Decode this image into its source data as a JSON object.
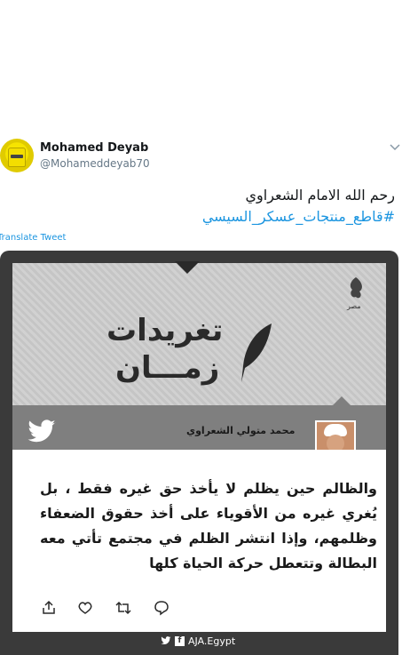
{
  "tweet": {
    "author_name": "Mohamed Deyab",
    "author_handle": "@Mohameddeyab70",
    "text_line1": "رحم الله الامام الشعراوي",
    "hashtag": "#قاطع_منتجات_عسكر_السيسي",
    "translate_label": "Translate Tweet"
  },
  "card": {
    "brand_text": "مصر",
    "title_line1": "تغريدات",
    "title_line2": "زمـــان",
    "author_label": "محمد متولي الشعراوي",
    "quote": "والظالم حين يظلم لا يأخذ حق غيره فقط ، بل يُغري غيره من الأقوياء على أخذ حقوق الضعفاء وظلمهم، وإذا انتشر الظلم في مجتمع تأتي معه البطالة وتتعطل حركة الحياة كلها",
    "footer_handle": "AJA.Egypt"
  },
  "icons": {
    "caret": "chevron-down-icon",
    "share": "share-icon",
    "like": "heart-icon",
    "retweet": "retweet-icon",
    "reply": "reply-icon",
    "bird": "twitter-bird-icon",
    "facebook": "facebook-icon"
  },
  "colors": {
    "link": "#1b95e0",
    "card_dark": "#3a3a3a",
    "card_bar": "#7f7f7f"
  }
}
